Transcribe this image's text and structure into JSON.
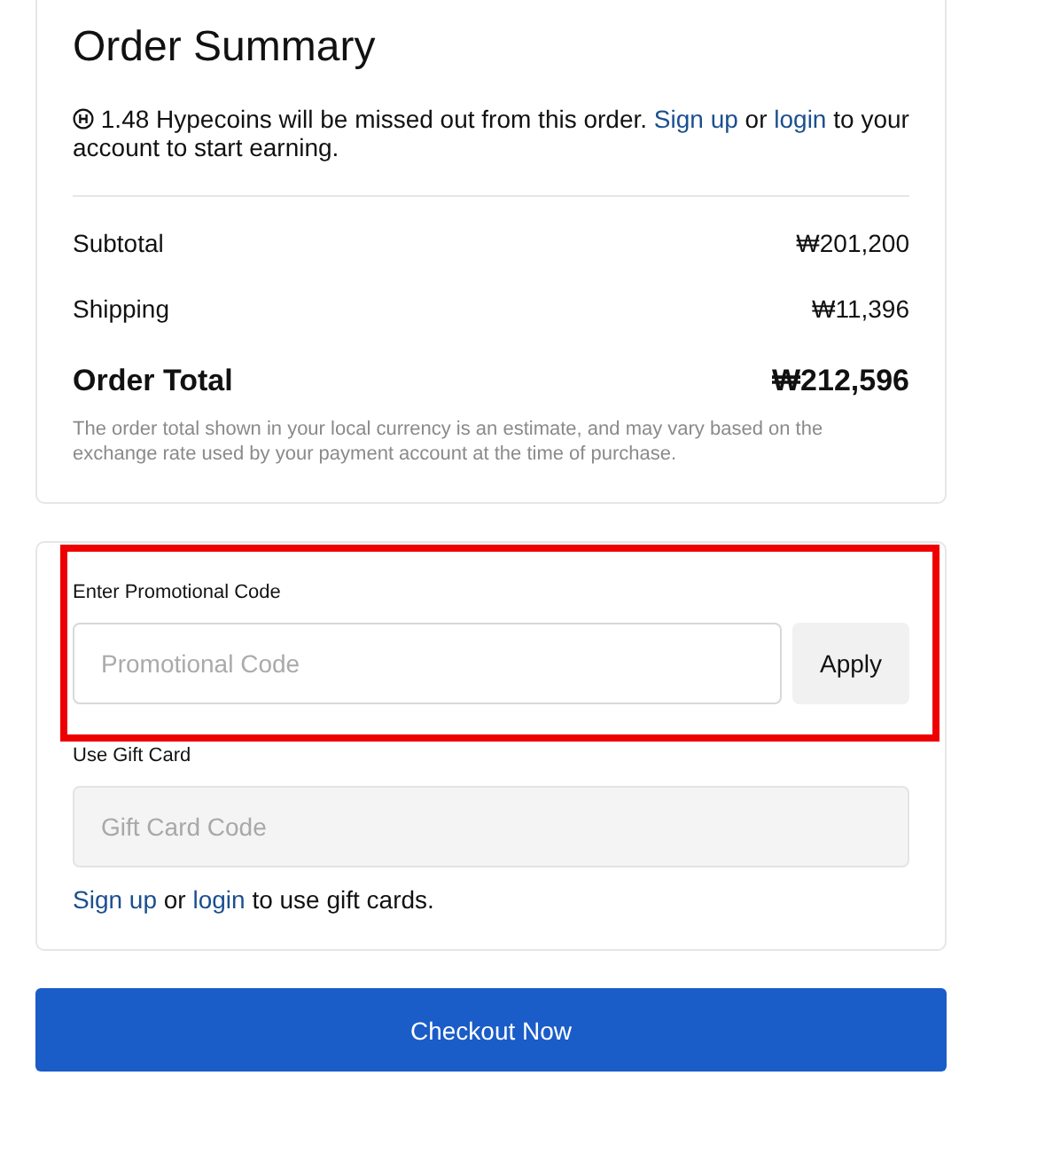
{
  "summary": {
    "title": "Order Summary",
    "notice": {
      "before": "1.48 Hypecoins will be missed out from this order.",
      "signup": "Sign up",
      "middle": "or",
      "login": "login",
      "after": "to your account to start earning."
    },
    "lines": [
      {
        "label": "Subtotal",
        "amount": "₩201,200",
        "kind": "normal"
      },
      {
        "label": "Shipping",
        "amount": "₩11,396",
        "kind": "normal"
      },
      {
        "label": "Order Total",
        "amount": "₩212,596",
        "kind": "total"
      }
    ],
    "disclaimer": "The order total shown in your local currency is an estimate, and may vary based on the exchange rate used by your payment account at the time of purchase."
  },
  "promo": {
    "label": "Enter Promotional Code",
    "placeholder": "Promotional Code",
    "button": "Apply",
    "highlighted": true
  },
  "gift_card": {
    "label": "Use Gift Card",
    "placeholder": "Gift Card Code",
    "disabled": true,
    "signup": "Sign up",
    "middle": "or",
    "login": "login",
    "after": "to use gift cards."
  },
  "checkout_button": "Checkout Now"
}
